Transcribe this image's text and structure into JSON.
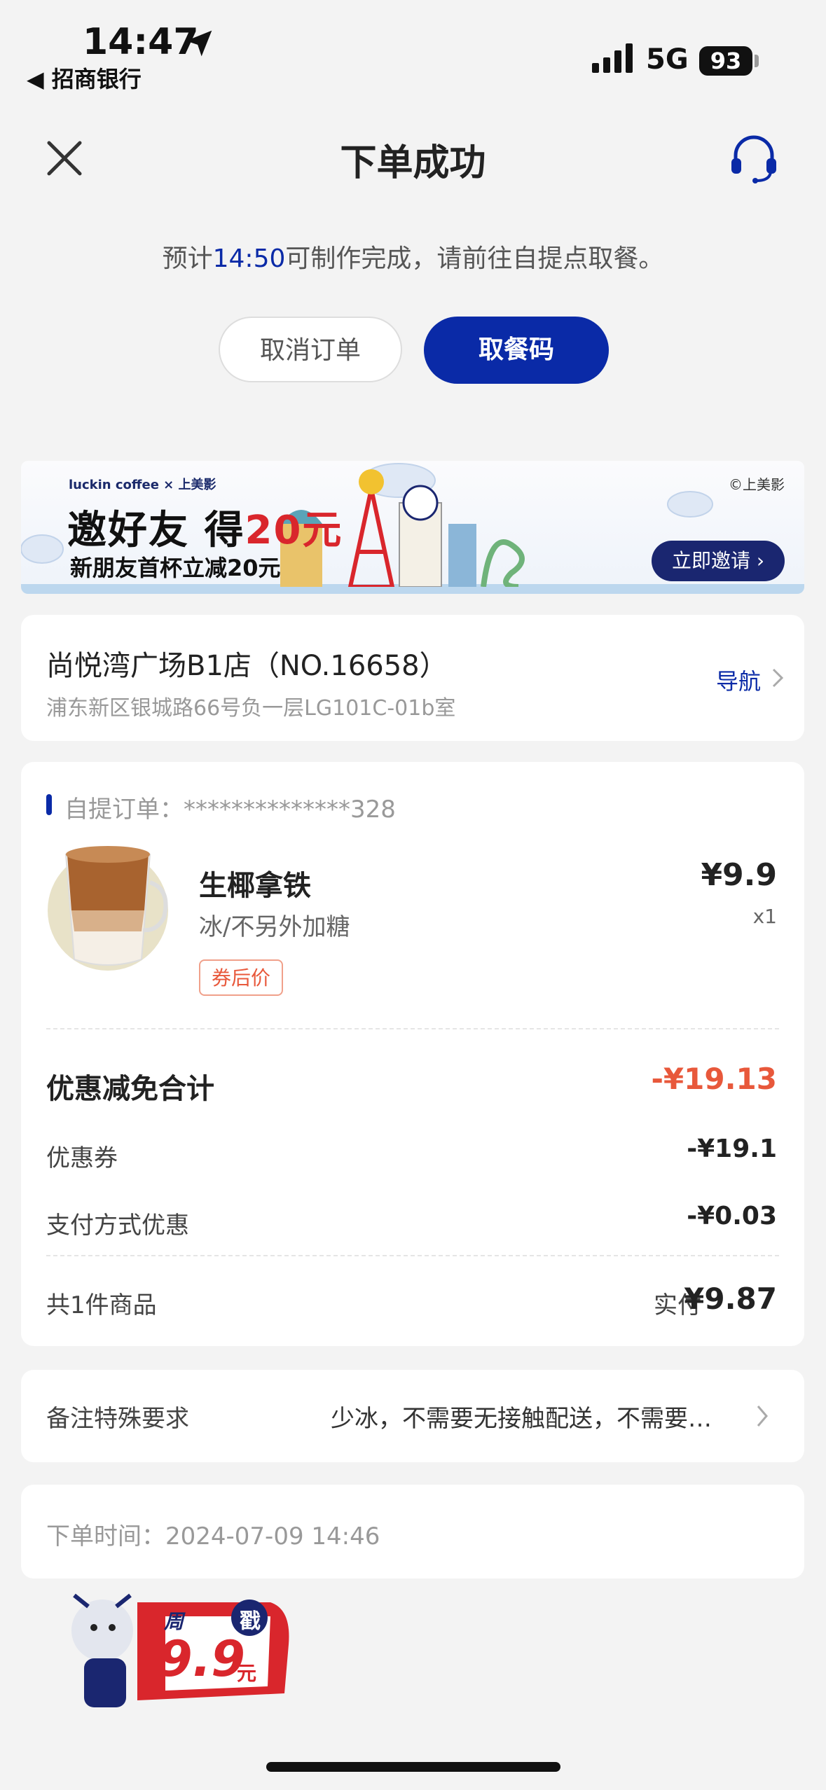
{
  "status_bar": {
    "time": "14:47",
    "back_app": "◀ 招商银行",
    "network": "5G",
    "battery": "93"
  },
  "header": {
    "title": "下单成功",
    "close_icon": "close-icon",
    "support_icon": "headset-icon"
  },
  "eta": {
    "prefix": "预计",
    "time": "14:50",
    "suffix": "可制作完成，请前往自提点取餐。"
  },
  "actions": {
    "cancel_label": "取消订单",
    "code_label": "取餐码"
  },
  "banner": {
    "brand": "luckin coffee × 上美影",
    "headline_main": "邀好友 得",
    "headline_amount": "20元",
    "subline": "新朋友首杯立减20元",
    "copyright": "©上美影",
    "button_label": "立即邀请"
  },
  "store": {
    "name": "尚悦湾广场B1店（NO.16658）",
    "address": "浦东新区银城路66号负一层LG101C-01b室",
    "nav_label": "导航"
  },
  "order": {
    "type_label": "自提订单：",
    "number": "**************328",
    "item": {
      "name": "生椰拿铁",
      "spec": "冰/不另外加糖",
      "tag": "券后价",
      "price": "¥9.9",
      "qty": "x1"
    },
    "discount_total_label": "优惠减免合计",
    "discount_total_value": "-¥19.13",
    "coupon_label": "优惠券",
    "coupon_value": "-¥19.1",
    "pay_discount_label": "支付方式优惠",
    "pay_discount_value": "-¥0.03",
    "count_label": "共1件商品",
    "paid_label": "实付",
    "paid_value": "¥9.87"
  },
  "remark": {
    "label": "备注特殊要求",
    "value": "少冰，不需要无接触配送，不需要…"
  },
  "order_time": {
    "text": "下单时间：2024-07-09 14:46"
  },
  "promo_float": {
    "day": "周",
    "badge": "戳",
    "price": "9.9",
    "unit": "元"
  },
  "colors": {
    "brand_blue": "#0a2aa7",
    "discount_red": "#e8583b",
    "background": "#f3f3f3"
  }
}
